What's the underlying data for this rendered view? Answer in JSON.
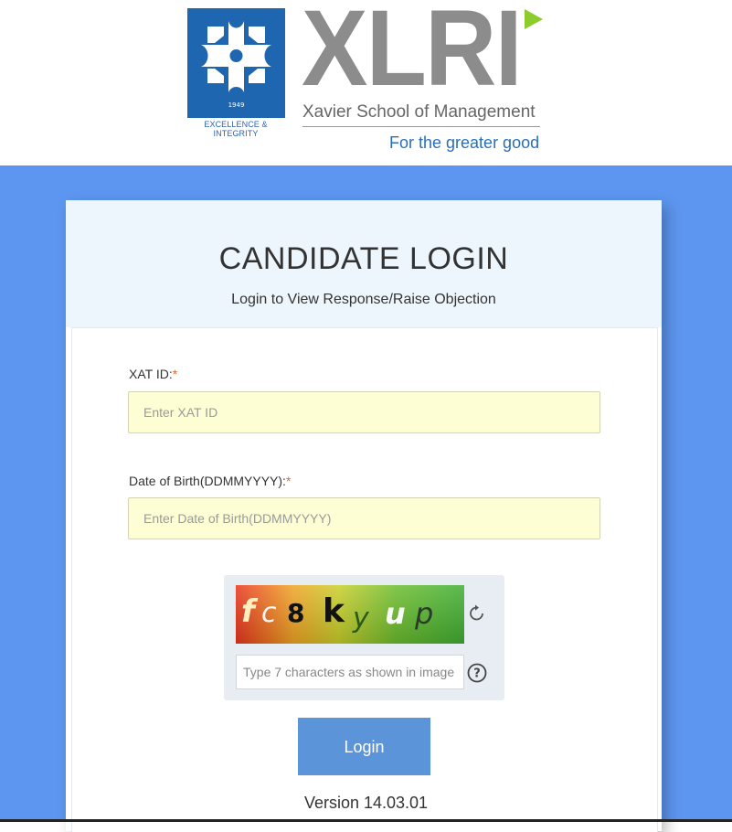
{
  "header": {
    "logo_text": "XLRI",
    "school_name": "Xavier School of Management",
    "motto": "For the greater good",
    "emblem_year": "1949",
    "emblem_tagline": "EXCELLENCE & INTEGRITY"
  },
  "login": {
    "title": "CANDIDATE LOGIN",
    "subtitle": "Login to View Response/Raise Objection",
    "xat_id": {
      "label": "XAT ID:",
      "required_mark": "*",
      "placeholder": "Enter XAT ID",
      "value": ""
    },
    "dob": {
      "label": "Date of Birth(DDMMYYYY):",
      "required_mark": "*",
      "placeholder": "Enter Date of Birth(DDMMYYYY)",
      "value": ""
    },
    "captcha": {
      "image_text": "fc8kyup",
      "placeholder": "Type 7 characters as shown in image",
      "refresh_icon": "refresh-icon",
      "help_icon": "help-icon"
    },
    "submit_label": "Login",
    "version": "Version 14.03.01"
  },
  "colors": {
    "band": "#5d96f0",
    "button": "#5b94d8",
    "input_bg": "#fdfed3",
    "logo_blue": "#1f66b1",
    "required": "#e06a2a"
  }
}
